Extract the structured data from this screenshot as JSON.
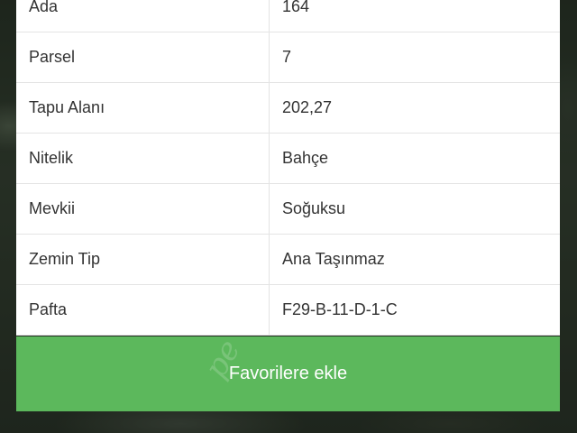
{
  "details": {
    "rows": [
      {
        "key": "Ada",
        "value": "164"
      },
      {
        "key": "Parsel",
        "value": "7"
      },
      {
        "key": "Tapu Alanı",
        "value": "202,27"
      },
      {
        "key": "Nitelik",
        "value": "Bahçe"
      },
      {
        "key": "Mevkii",
        "value": "Soğuksu"
      },
      {
        "key": "Zemin Tip",
        "value": "Ana Taşınmaz"
      },
      {
        "key": "Pafta",
        "value": "F29-B-11-D-1-C"
      }
    ]
  },
  "actions": {
    "favorite_label": "Favorilere ekle",
    "favorite_color": "#5cb85c"
  },
  "watermark": "ре"
}
